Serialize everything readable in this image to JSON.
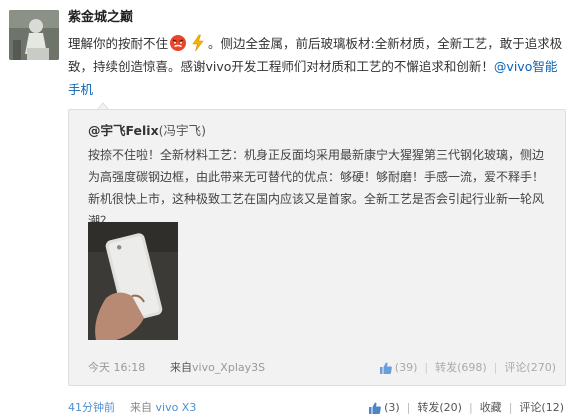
{
  "author": {
    "name": "紫金城之巅"
  },
  "post": {
    "text_before_emoji": "理解你的按耐不住",
    "text_after_emoji": "。侧边全金属，前后玻璃板材:全新材质，全新工艺，敢于追求极致，持续创造惊喜。感谢vivo开发工程师们对材质和工艺的不懈追求和创新！",
    "mention": "@vivo智能手机"
  },
  "quote": {
    "author": "@宇飞Felix",
    "author_nick": "冯宇飞",
    "text": "按捺不住啦！全新材料工艺：机身正反面均采用最新康宁大猩猩第三代钢化玻璃，侧边为高强度碳钢边框，由此带来无可替代的优点：够硬！够耐磨！手感一流，爱不释手！新机很快上市，这种极致工艺在国内应该又是首家。全新工艺是否会引起行业新一轮风潮？",
    "time": "今天 16:18",
    "from_label": "来自",
    "source": "vivo_Xplay3S",
    "likes": "39",
    "repost_label": "转发",
    "repost_count": "698",
    "comment_label": "评论",
    "comment_count": "270"
  },
  "footer": {
    "time": "41分钟前",
    "from_label": "来自",
    "source": "vivo X3",
    "likes": "3",
    "repost_label": "转发",
    "repost_count": "20",
    "favorite_label": "收藏",
    "comment_label": "评论",
    "comment_count": "12"
  }
}
